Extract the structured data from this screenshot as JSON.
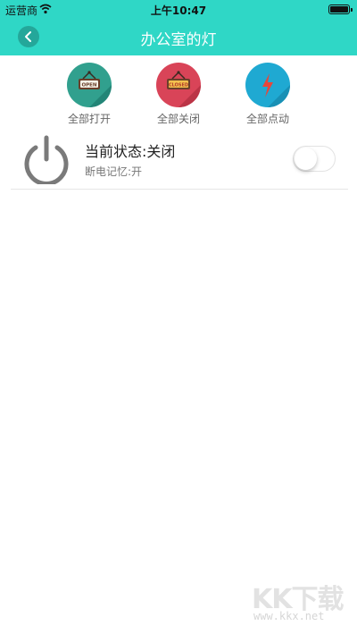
{
  "status_bar": {
    "carrier": "运营商",
    "time": "上午10:47"
  },
  "nav": {
    "title": "办公室的灯"
  },
  "actions": [
    {
      "label": "全部打开",
      "sign_text": "OPEN",
      "color": "#31a08e"
    },
    {
      "label": "全部关闭",
      "sign_text": "CLOSED",
      "color": "#d94458"
    },
    {
      "label": "全部点动",
      "color": "#1fa9d2"
    }
  ],
  "device": {
    "state_text": "当前状态:关闭",
    "memory_text": "断电记忆:开",
    "switch_on": false
  },
  "watermark": {
    "brand": "KK下载",
    "url": "www.kkx.net"
  }
}
